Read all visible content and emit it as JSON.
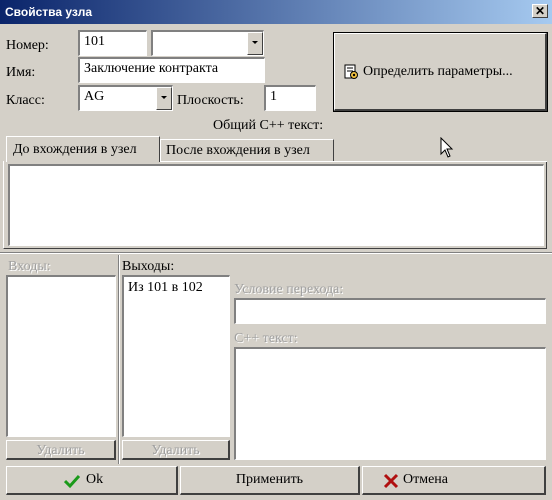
{
  "window": {
    "title": "Свойства узла",
    "close_glyph": "✕"
  },
  "header": {
    "number_label": "Номер:",
    "number_value": "101",
    "number_combo_value": "",
    "name_label": "Имя:",
    "name_value": "Заключение контракта",
    "class_label": "Класс:",
    "class_value": "AG",
    "plane_label": "Плоскость:",
    "plane_value": "1",
    "define_button": "Определить параметры..."
  },
  "common_cpp_label": "Общий C++ текст:",
  "tabs": [
    {
      "label": "До вхождения в узел",
      "active": true
    },
    {
      "label": "После вхождения в узел",
      "active": false
    }
  ],
  "editor_text": "",
  "inputs": {
    "label": "Входы:",
    "items": [],
    "delete_label": "Удалить"
  },
  "outputs": {
    "label": "Выходы:",
    "items": [
      "Из 101 в 102"
    ],
    "delete_label": "Удалить"
  },
  "transition": {
    "condition_label": "Условие перехода:",
    "condition_value": "",
    "cpp_label": "C++ текст:",
    "cpp_value": ""
  },
  "footer": {
    "ok_label": "Ok",
    "apply_label": "Применить",
    "cancel_label": "Отмена"
  },
  "colors": {
    "title_from": "#0a246a",
    "title_to": "#a6caf0",
    "face": "#d4d0c8",
    "ok_check": "#1a9a1a",
    "cancel_x": "#b01010"
  },
  "icons": {
    "define": "properties-icon",
    "ok": "check-icon",
    "cancel": "x-icon",
    "close": "close-icon"
  }
}
